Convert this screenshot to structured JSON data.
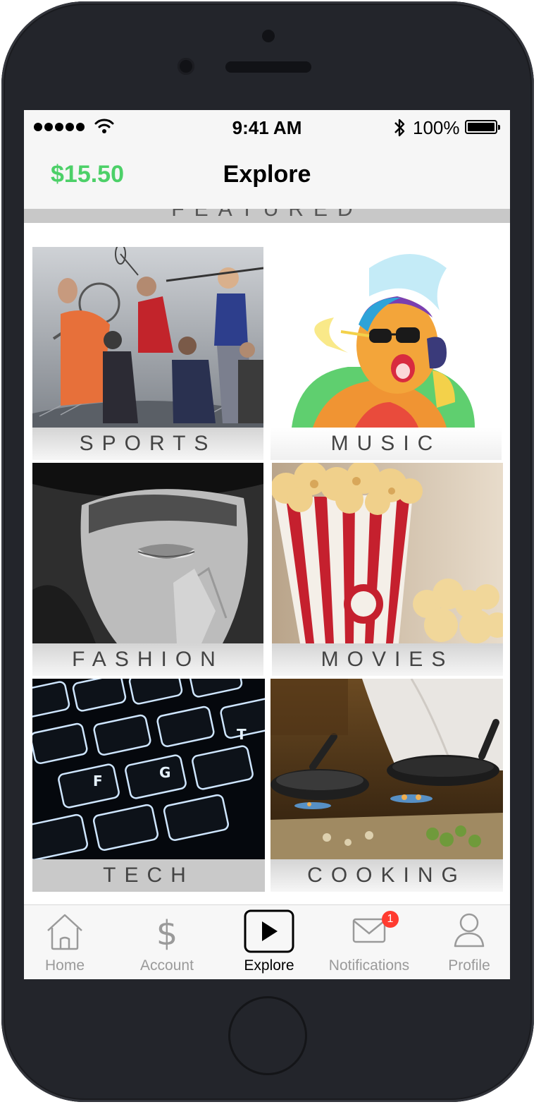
{
  "status_bar": {
    "time": "9:41 AM",
    "battery_percent": "100%",
    "signal_bars": 5
  },
  "nav": {
    "balance": "$15.50",
    "title": "Explore"
  },
  "featured_label": "FEATURED",
  "categories": [
    {
      "label": "SPORTS"
    },
    {
      "label": "MUSIC"
    },
    {
      "label": "FASHION"
    },
    {
      "label": "MOVIES"
    },
    {
      "label": "TECH"
    },
    {
      "label": "COOKING"
    }
  ],
  "tabs": [
    {
      "label": "Home",
      "icon": "home-icon"
    },
    {
      "label": "Account",
      "icon": "dollar-icon"
    },
    {
      "label": "Explore",
      "icon": "play-icon",
      "active": true
    },
    {
      "label": "Notifications",
      "icon": "mail-icon",
      "badge": "1"
    },
    {
      "label": "Profile",
      "icon": "person-icon"
    }
  ],
  "colors": {
    "balance_green": "#4cd068",
    "badge_red": "#ff3b30",
    "tab_inactive": "#9a9a9a"
  }
}
